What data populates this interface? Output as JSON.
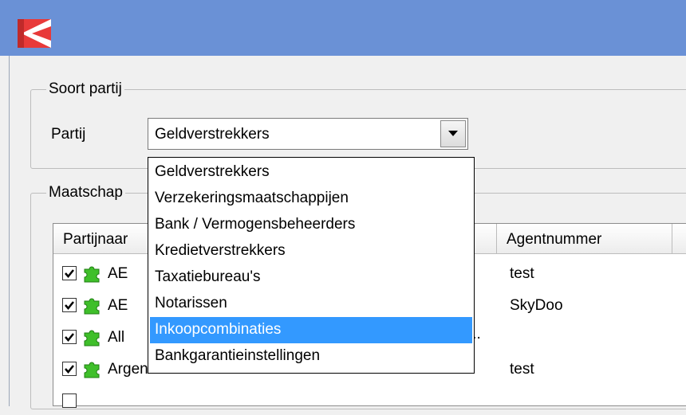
{
  "titlebar": {
    "icon": "app-logo-icon"
  },
  "soort_partij": {
    "legend": "Soort partij",
    "partij_label": "Partij",
    "selected_value": "Geldverstrekkers"
  },
  "dropdown": {
    "options": [
      "Geldverstrekkers",
      "Verzekeringsmaatschappijen",
      "Bank / Vermogensbeheerders",
      "Kredietverstrekkers",
      "Taxatiebureau's",
      "Notarissen",
      "Inkoopcombinaties",
      "Bankgarantieinstellingen"
    ],
    "highlighted_index": 6
  },
  "maatschappijen": {
    "legend": "Maatschap",
    "columns": [
      "Partijnaar",
      "Agentnummer"
    ],
    "rows": [
      {
        "checked": true,
        "name": "AE",
        "agent": "test"
      },
      {
        "checked": true,
        "name": "AE",
        "agent": "SkyDoo"
      },
      {
        "checked": true,
        "name": "All",
        "agent": "",
        "trailing": "..."
      },
      {
        "checked": true,
        "name": "Argenta",
        "agent": "test"
      }
    ]
  },
  "colors": {
    "titlebar": "#6a91d6",
    "selection": "#3399ff",
    "logo": "#e83a3a"
  }
}
